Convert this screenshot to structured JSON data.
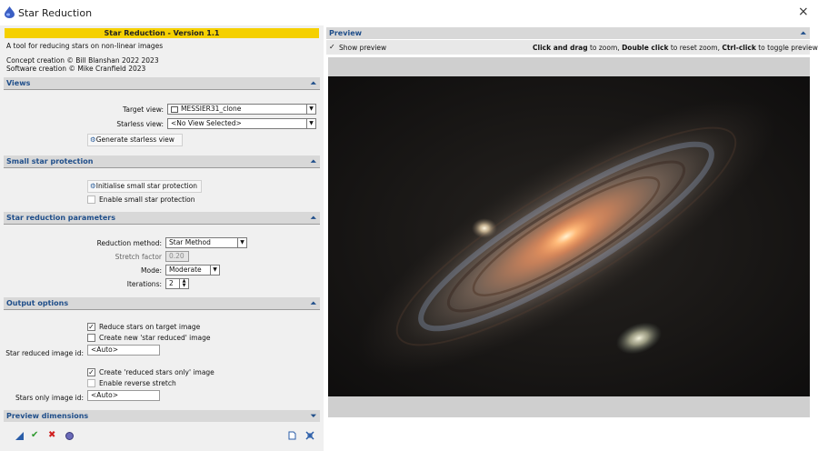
{
  "window": {
    "title": "Star Reduction",
    "close_glyph": "×"
  },
  "header": {
    "banner": "Star Reduction - Version 1.1",
    "description": "A tool for reducing stars on non-linear images",
    "credit1": "Concept creation © Bill Blanshan 2022 2023",
    "credit2": "Software creation © Mike Cranfield 2023"
  },
  "views": {
    "title": "Views",
    "target_label": "Target view:",
    "target_value": "MESSIER31_clone",
    "starless_label": "Starless view:",
    "starless_value": "<No View Selected>",
    "generate_button": "Generate starless view"
  },
  "small_star": {
    "title": "Small star protection",
    "init_button": "Initialise small star protection",
    "enable_label": "Enable small star protection",
    "enable_checked": false
  },
  "params": {
    "title": "Star reduction parameters",
    "method_label": "Reduction method:",
    "method_value": "Star Method",
    "stretch_label": "Stretch factor",
    "stretch_value": "0.20",
    "mode_label": "Mode:",
    "mode_value": "Moderate",
    "iter_label": "Iterations:",
    "iter_value": "2"
  },
  "output": {
    "title": "Output options",
    "reduce_label": "Reduce stars on target image",
    "reduce_checked": true,
    "create_new_label": "Create new 'star reduced' image",
    "create_new_checked": false,
    "reduced_id_label": "Star reduced image id:",
    "reduced_id_value": "<Auto>",
    "stars_only_label": "Create 'reduced stars only' image",
    "stars_only_checked": true,
    "reverse_label": "Enable reverse stretch",
    "reverse_checked": false,
    "stars_id_label": "Stars only image id:",
    "stars_id_value": "<Auto>"
  },
  "preview_dims": {
    "title": "Preview dimensions"
  },
  "preview": {
    "title": "Preview",
    "show_label": "Show preview",
    "show_checked": true,
    "help_1": "Click and drag",
    "help_2": " to zoom, ",
    "help_3": "Double click",
    "help_4": " to reset zoom, ",
    "help_5": "Ctrl-click",
    "help_6": " to toggle preview"
  },
  "icons": [
    "app-logo-icon",
    "close-icon",
    "collapse-icon",
    "expand-icon",
    "image-view-icon",
    "gear-icon",
    "new-instance-icon",
    "ok-check-icon",
    "cancel-x-icon",
    "reset-icon",
    "document-icon",
    "fit-icon"
  ],
  "colors": {
    "accent": "#1f4e8a",
    "banner": "#f5d000",
    "ok": "#2e9a2e",
    "cancel": "#d02020"
  }
}
